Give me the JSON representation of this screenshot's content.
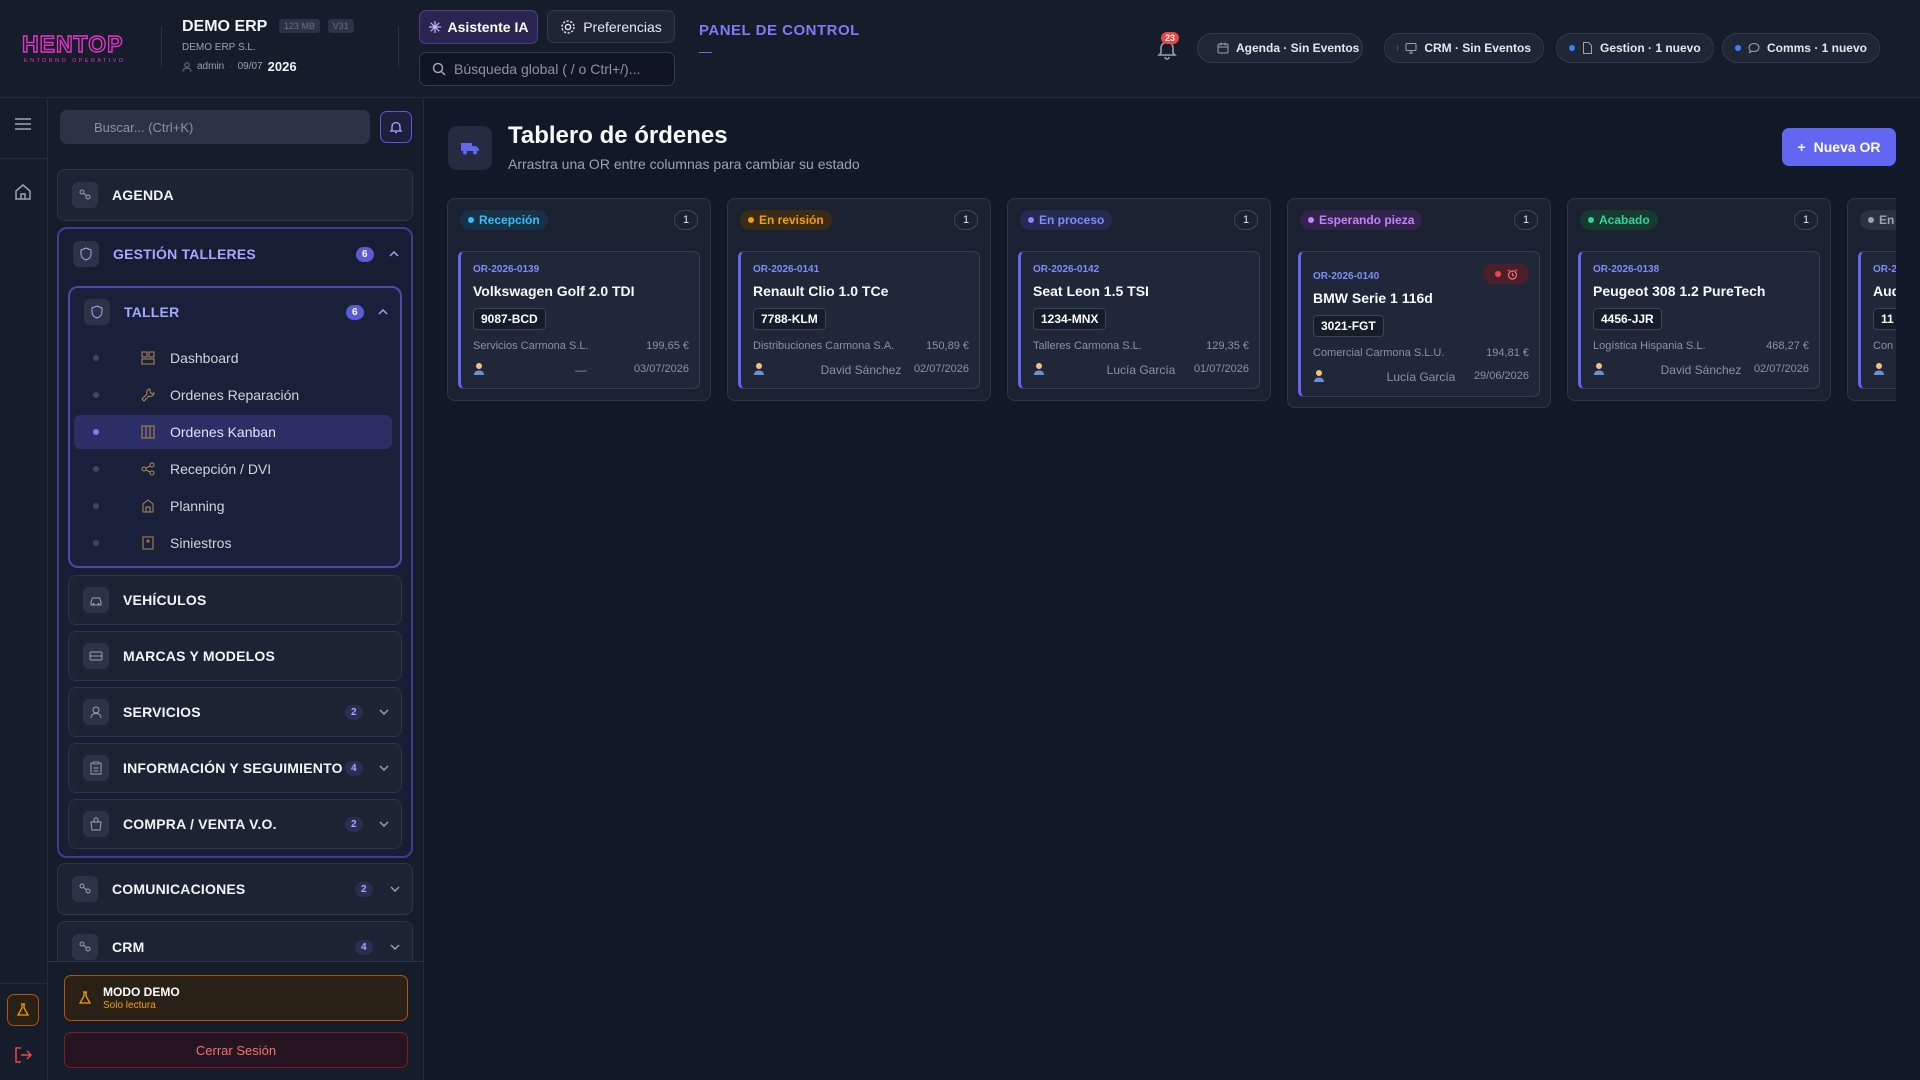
{
  "brand": {
    "logo_text": "HENTOP",
    "tagline": "ENTORNO OPERATIVO",
    "logo_color": "#e535c8"
  },
  "header": {
    "company": "DEMO ERP",
    "memory_badge": "123 MB",
    "version_badge": "V31",
    "legal_name": "DEMO ERP S.L.",
    "user": "admin",
    "date": "09/07",
    "year": "2026",
    "assistant_button": "Asistente IA",
    "preferences_button": "Preferencias",
    "search_placeholder": "Búsqueda global ( / o Ctrl+/)...",
    "panel_title": "PANEL DE CONTROL",
    "panel_sub": "—",
    "notifications_count": "23",
    "pills": [
      {
        "label": "Agenda · Sin Eventos",
        "dot": "#4b5563",
        "icon": "calendar-icon"
      },
      {
        "label": "CRM · Sin Eventos",
        "dot": "#4b5563",
        "icon": "monitor-icon"
      },
      {
        "label": "Gestion · 1 nuevo",
        "dot": "#3b82f6",
        "icon": "document-icon"
      },
      {
        "label": "Comms · 1 nuevo",
        "dot": "#3b82f6",
        "icon": "chat-icon"
      }
    ]
  },
  "sidebar": {
    "search_placeholder": "Buscar... (Ctrl+K)",
    "agenda": "AGENDA",
    "gestion": {
      "label": "GESTIÓN TALLERES",
      "count": "6"
    },
    "taller": {
      "label": "TALLER",
      "count": "6"
    },
    "taller_items": [
      {
        "label": "Dashboard",
        "icon": "dashboard-icon"
      },
      {
        "label": "Ordenes Reparación",
        "icon": "wrench-icon"
      },
      {
        "label": "Ordenes Kanban",
        "icon": "kanban-icon",
        "active": true
      },
      {
        "label": "Recepción / DVI",
        "icon": "share-icon"
      },
      {
        "label": "Planning",
        "icon": "building-icon"
      },
      {
        "label": "Siniestros",
        "icon": "flag-icon"
      }
    ],
    "vehiculos": "VEHÍCULOS",
    "marcas": "MARCAS Y MODELOS",
    "servicios": {
      "label": "SERVICIOS",
      "count": "2"
    },
    "informacion": {
      "label": "INFORMACIÓN Y SEGUIMIENTO",
      "count": "4"
    },
    "compra": {
      "label": "COMPRA / VENTA V.O.",
      "count": "2"
    },
    "comunicaciones": {
      "label": "COMUNICACIONES",
      "count": "2"
    },
    "crm": {
      "label": "CRM",
      "count": "4"
    },
    "demo_title": "MODO DEMO",
    "demo_sub": "Solo lectura",
    "logout": "Cerrar Sesión"
  },
  "main": {
    "title": "Tablero de órdenes",
    "subtitle": "Arrastra una OR entre columnas para cambiar su estado",
    "new_button": "Nueva OR",
    "columns": [
      {
        "status": "Recepción",
        "color": "#38bdf8",
        "bg": "#173247",
        "count": "1",
        "card": {
          "id": "OR-2026-0139",
          "model": "Volkswagen Golf 2.0 TDI",
          "plate": "9087-BCD",
          "client": "Servicios Carmona S.L.",
          "price": "199,65 €",
          "tech": "—",
          "date": "03/07/2026"
        }
      },
      {
        "status": "En revisión",
        "color": "#f59e0b",
        "bg": "#3a2b16",
        "count": "1",
        "card": {
          "id": "OR-2026-0141",
          "model": "Renault Clio 1.0 TCe",
          "plate": "7788-KLM",
          "client": "Distribuciones Carmona S.A.",
          "price": "150,89 €",
          "tech": "David Sánchez",
          "date": "02/07/2026"
        }
      },
      {
        "status": "En proceso",
        "color": "#818cf8",
        "bg": "#262a50",
        "count": "1",
        "card": {
          "id": "OR-2026-0142",
          "model": "Seat Leon 1.5 TSI",
          "plate": "1234-MNX",
          "client": "Talleres Carmona S.L.",
          "price": "129,35 €",
          "tech": "Lucía García",
          "date": "01/07/2026"
        }
      },
      {
        "status": "Esperando pieza",
        "color": "#c084fc",
        "bg": "#33224a",
        "count": "1",
        "card": {
          "id": "OR-2026-0140",
          "model": "BMW Serie 1 116d",
          "plate": "3021-FGT",
          "client": "Comercial Carmona S.L.U.",
          "price": "194,81 €",
          "tech": "Lucía García",
          "date": "29/06/2026",
          "alarm": true
        }
      },
      {
        "status": "Acabado",
        "color": "#34d399",
        "bg": "#163a30",
        "count": "1",
        "card": {
          "id": "OR-2026-0138",
          "model": "Peugeot 308 1.2 PureTech",
          "plate": "4456-JJR",
          "client": "Logística Hispania S.L.",
          "price": "468,27 €",
          "tech": "David Sánchez",
          "date": "02/07/2026"
        }
      },
      {
        "status": "En",
        "color": "#9ca3af",
        "bg": "#2a3242",
        "count": "",
        "card": {
          "id": "OR-2",
          "model": "Aud",
          "plate": "11",
          "client": "Con",
          "price": "",
          "tech": "",
          "date": ""
        }
      }
    ]
  }
}
